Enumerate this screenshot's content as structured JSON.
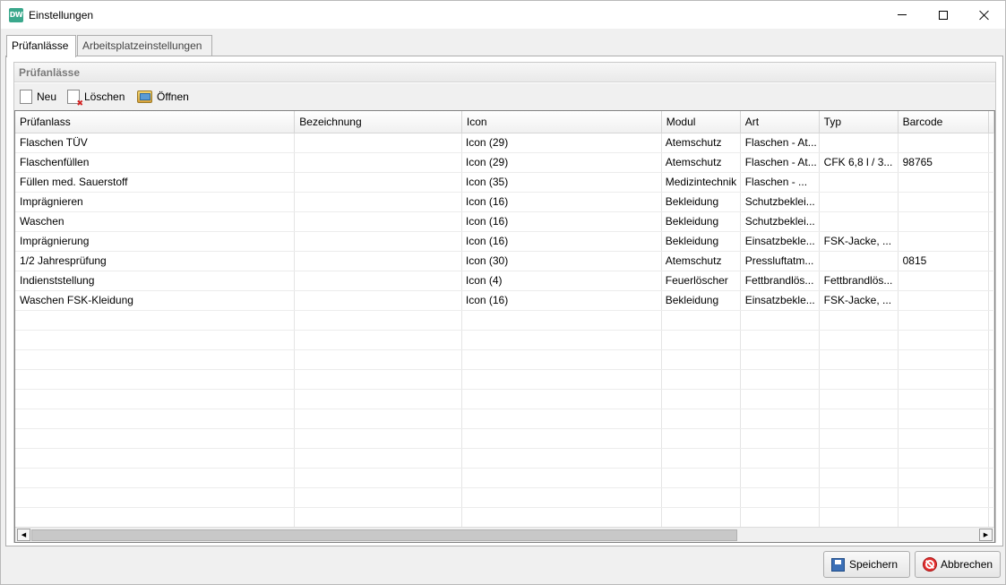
{
  "window": {
    "title": "Einstellungen",
    "app_icon_text": "DW"
  },
  "tabs": [
    {
      "label": "Prüfanlässe",
      "active": true
    },
    {
      "label": "Arbeitsplatzeinstellungen",
      "active": false
    }
  ],
  "group": {
    "title": "Prüfanlässe"
  },
  "toolbar": {
    "new_label": "Neu",
    "delete_label": "Löschen",
    "open_label": "Öffnen"
  },
  "table": {
    "columns": [
      "Prüfanlass",
      "Bezeichnung",
      "Icon",
      "Modul",
      "Art",
      "Typ",
      "Barcode"
    ],
    "rows": [
      [
        "Flaschen TÜV",
        "",
        "Icon (29)",
        "Atemschutz",
        "Flaschen - At...",
        "",
        ""
      ],
      [
        "Flaschenfüllen",
        "",
        "Icon (29)",
        "Atemschutz",
        "Flaschen - At...",
        "CFK 6,8 l / 3...",
        "98765"
      ],
      [
        "Füllen med. Sauerstoff",
        "",
        "Icon (35)",
        "Medizintechnik",
        "Flaschen - ...",
        "",
        ""
      ],
      [
        "Imprägnieren",
        "",
        "Icon (16)",
        "Bekleidung",
        "Schutzbeklei...",
        "",
        ""
      ],
      [
        "Waschen",
        "",
        "Icon (16)",
        "Bekleidung",
        "Schutzbeklei...",
        "",
        ""
      ],
      [
        "Imprägnierung",
        "",
        "Icon (16)",
        "Bekleidung",
        "Einsatzbekle...",
        "FSK-Jacke, ...",
        ""
      ],
      [
        "1/2 Jahresprüfung",
        "",
        "Icon (30)",
        "Atemschutz",
        "Pressluftatm...",
        "",
        "0815"
      ],
      [
        "Indienststellung",
        "",
        "Icon (4)",
        "Feuerlöscher",
        "Fettbrandlös...",
        "Fettbrandlös...",
        ""
      ],
      [
        "Waschen FSK-Kleidung",
        "",
        "Icon (16)",
        "Bekleidung",
        "Einsatzbekle...",
        "FSK-Jacke, ...",
        ""
      ]
    ]
  },
  "buttons": {
    "save_label": "Speichern",
    "cancel_label": "Abbrechen"
  }
}
